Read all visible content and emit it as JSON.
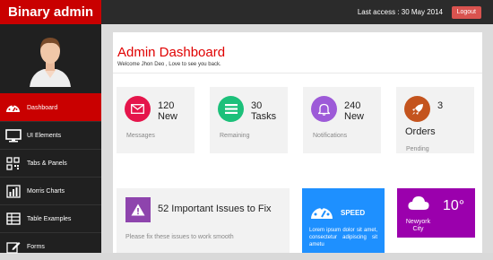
{
  "header": {
    "brand": "Binary admin",
    "last_access": "Last access : 30 May 2014",
    "logout": "Logout"
  },
  "sidebar": {
    "items": [
      {
        "label": "Dashboard",
        "icon": "dashboard-icon",
        "active": true
      },
      {
        "label": "UI Elements",
        "icon": "desktop-icon",
        "active": false
      },
      {
        "label": "Tabs & Panels",
        "icon": "qrcode-icon",
        "active": false
      },
      {
        "label": "Morris Charts",
        "icon": "bar-chart-icon",
        "active": false
      },
      {
        "label": "Table Examples",
        "icon": "table-icon",
        "active": false
      },
      {
        "label": "Forms",
        "icon": "edit-icon",
        "active": false
      }
    ]
  },
  "main": {
    "title": "Admin Dashboard",
    "welcome": "Welcome Jhon Deo , Love to see you back.",
    "stats": [
      {
        "value_line1": "120",
        "value_line2": "New",
        "label": "Messages",
        "color": "#e5154b",
        "icon": "envelope-icon"
      },
      {
        "value_line1": "30",
        "value_line2": "Tasks",
        "label": "Remaining",
        "color": "#1cc07a",
        "icon": "list-icon"
      },
      {
        "value_line1": "240",
        "value_line2": "New",
        "label": "Notifications",
        "color": "#9d5ad8",
        "icon": "bell-icon"
      },
      {
        "value_line1": "3",
        "value_line2": "Orders",
        "label": "Pending",
        "color": "#c4541e",
        "icon": "rocket-icon"
      }
    ],
    "issues": {
      "title": "52 Important Issues to Fix",
      "subtitle": "Please fix these issues to work smooth",
      "icon": "warning-icon"
    },
    "speed": {
      "title": "SPEED",
      "text": "Lorem ipsum dolor sit amet, consectetur adipiscing sit ametu",
      "icon": "dashboard-icon"
    },
    "weather": {
      "temp": "10°",
      "city": "Newyork City",
      "icon": "cloud-icon"
    }
  }
}
